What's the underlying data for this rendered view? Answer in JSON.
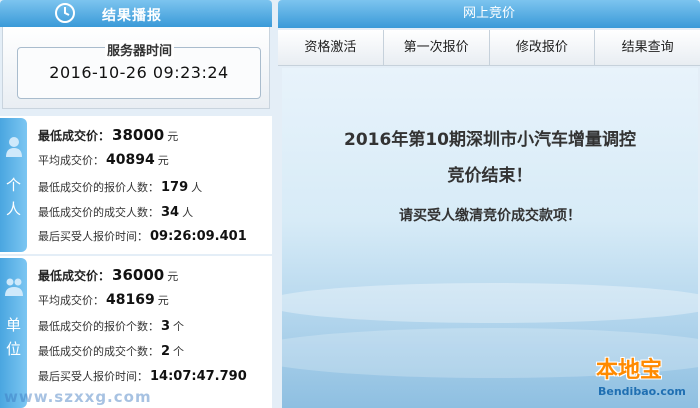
{
  "left": {
    "header_title": "结果播报",
    "server": {
      "label": "服务器时间",
      "time": "2016-10-26 09:23:24"
    },
    "personal": {
      "tab_chars": [
        "个",
        "人"
      ],
      "rows": [
        {
          "k": "最低成交价：",
          "v": "38000",
          "u": "元"
        },
        {
          "k": "平均成交价：",
          "v": "40894",
          "u": "元"
        },
        {
          "k": "最低成交价的报价人数：",
          "v": "179",
          "u": "人"
        },
        {
          "k": "最低成交价的成交人数：",
          "v": "34",
          "u": "人"
        },
        {
          "k": "最后买受人报价时间：",
          "v": "09:26:09.401"
        }
      ]
    },
    "unit": {
      "tab_chars": [
        "单",
        "位"
      ],
      "rows": [
        {
          "k": "最低成交价：",
          "v": "36000",
          "u": "元"
        },
        {
          "k": "平均成交价：",
          "v": "48169",
          "u": "元"
        },
        {
          "k": "最低成交价的报价个数：",
          "v": "3",
          "u": "个"
        },
        {
          "k": "最低成交价的成交个数：",
          "v": "2",
          "u": "个"
        },
        {
          "k": "最后买受人报价时间：",
          "v": "14:07:47.790"
        }
      ]
    }
  },
  "right": {
    "header_title": "网上竞价",
    "tabs": [
      "资格激活",
      "第一次报价",
      "修改报价",
      "结果查询"
    ],
    "message_line1": "2016年第10期深圳市小汽车增量调控",
    "message_line2": "竞价结束！",
    "message_line3": "请买受人缴清竞价成交款项！"
  },
  "watermarks": {
    "logo_main": "本地宝",
    "logo_sub": "Bendibao.com",
    "left_mark": "www.szxxg.com"
  },
  "colors": {
    "accent": "#3a9ad8",
    "accent_light": "#7cc4ef",
    "logo_orange": "#ff8a00"
  },
  "icons": {
    "header_left": "clock-icon",
    "personal_tab": "person-icon",
    "unit_tab": "group-icon"
  }
}
